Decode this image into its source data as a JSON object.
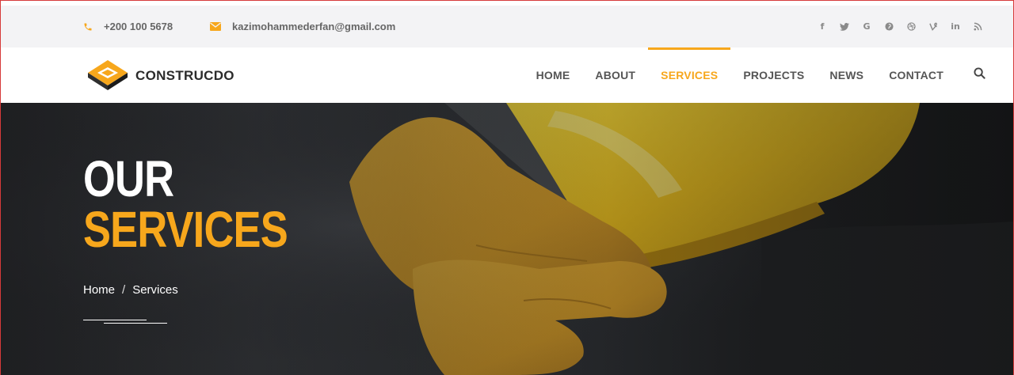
{
  "topbar": {
    "phone": "+200 100 5678",
    "email": "kazimohammederfan@gmail.com",
    "icons": {
      "phone": "phone-icon",
      "email": "envelope-icon"
    },
    "socials": [
      {
        "name": "facebook-icon",
        "glyph": "f"
      },
      {
        "name": "twitter-icon",
        "glyph": "t"
      },
      {
        "name": "google-icon",
        "glyph": "G"
      },
      {
        "name": "pinterest-icon",
        "glyph": "p"
      },
      {
        "name": "dribbble-icon",
        "glyph": "⊛"
      },
      {
        "name": "vine-icon",
        "glyph": "v"
      },
      {
        "name": "linkedin-icon",
        "glyph": "in"
      },
      {
        "name": "rss-icon",
        "glyph": "❭"
      }
    ]
  },
  "brand": {
    "name": "CONSTRUCDO"
  },
  "nav": {
    "items": [
      {
        "label": "HOME",
        "active": false
      },
      {
        "label": "ABOUT",
        "active": false
      },
      {
        "label": "SERVICES",
        "active": true
      },
      {
        "label": "PROJECTS",
        "active": false
      },
      {
        "label": "NEWS",
        "active": false
      },
      {
        "label": "CONTACT",
        "active": false
      }
    ],
    "search_icon": "search-icon"
  },
  "hero": {
    "title_line1": "OUR",
    "title_line2": "SERVICES",
    "breadcrumb": {
      "home": "Home",
      "separator": "/",
      "current": "Services"
    }
  },
  "colors": {
    "accent": "#f7a71c",
    "topbar_bg": "#f3f3f5",
    "hero_bg": "#2d3034",
    "glove": "#e3a92a",
    "helmet": "#f2c51a"
  }
}
